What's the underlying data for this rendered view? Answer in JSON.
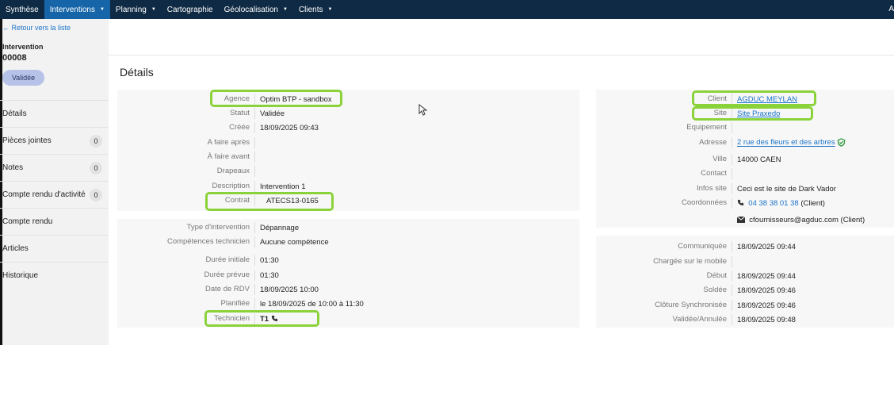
{
  "topnav": {
    "items": [
      {
        "label": "Synthèse",
        "caret": false
      },
      {
        "label": "Interventions",
        "caret": true
      },
      {
        "label": "Planning",
        "caret": true
      },
      {
        "label": "Cartographie",
        "caret": false
      },
      {
        "label": "Géolocalisation",
        "caret": true
      },
      {
        "label": "Clients",
        "caret": true
      }
    ],
    "right_text": "A"
  },
  "sidebar": {
    "back_link": "Retour vers la liste",
    "title": "Intervention",
    "number": "00008",
    "status": "Validée",
    "menu": [
      {
        "label": "Détails",
        "count": ""
      },
      {
        "label": "Pièces jointes",
        "count": "0"
      },
      {
        "label": "Notes",
        "count": "0"
      },
      {
        "label": "Compte rendu d'activité",
        "count": "0"
      },
      {
        "label": "Compte rendu",
        "count": ""
      },
      {
        "label": "Articles",
        "count": ""
      },
      {
        "label": "Historique",
        "count": ""
      }
    ]
  },
  "main": {
    "title": "Détails",
    "left_top": [
      {
        "label": "Agence",
        "value": "Optim BTP - sandbox"
      },
      {
        "label": "Statut",
        "value": "Validée"
      },
      {
        "label": "Créée",
        "value": "18/09/2025 09:43"
      },
      {
        "label": "A faire après",
        "value": ""
      },
      {
        "label": "À faire avant",
        "value": ""
      },
      {
        "label": "Drapeaux",
        "value": ""
      },
      {
        "label": "Description",
        "value": "Intervention 1"
      },
      {
        "label": "Contrat",
        "value": "ATECS13-0165"
      }
    ],
    "left_bottom": [
      {
        "label": "Type d'intervention",
        "value": "Dépannage"
      },
      {
        "label": "Compétences technicien",
        "value": "Aucune compétence"
      },
      {
        "label": "Durée initiale",
        "value": "01:30"
      },
      {
        "label": "Durée prévue",
        "value": "01:30"
      },
      {
        "label": "Date de RDV",
        "value": "18/09/2025 10:00"
      },
      {
        "label": "Planifiée",
        "value": "le 18/09/2025 de 10:00 à 11:30"
      },
      {
        "label": "Technicien",
        "value": "T1"
      }
    ],
    "right_top": {
      "client_label": "Client",
      "client_value": "AGDUC MEYLAN",
      "site_label": "Site",
      "site_value": "Site Praxedo",
      "equipement_label": "Equipement",
      "equipement_value": "",
      "adresse_label": "Adresse",
      "adresse_value": "2 rue des fleurs et des arbres",
      "ville_label": "Ville",
      "ville_value": "14000 CAEN",
      "contact_label": "Contact",
      "contact_value": "",
      "infos_label": "Infos site",
      "infos_value": "Ceci est le site de Dark Vador",
      "coord_label": "Coordonnées",
      "phone": "04 38 38 01 38",
      "phone_suffix": "(Client)",
      "email": "cfournisseurs@agduc.com (Client)"
    },
    "right_bottom": [
      {
        "label": "Communiquée",
        "value": "18/09/2025 09:44"
      },
      {
        "label": "Chargée sur le mobile",
        "value": ""
      },
      {
        "label": "Début",
        "value": "18/09/2025 09:44"
      },
      {
        "label": "Soldée",
        "value": "18/09/2025 09:46"
      },
      {
        "label": "Clôture Synchronisée",
        "value": "18/09/2025 09:46"
      },
      {
        "label": "Validée/Annulée",
        "value": "18/09/2025 09:48"
      }
    ]
  },
  "colors": {
    "nav_bg": "#0f2a44",
    "nav_active": "#1565a8",
    "highlight": "#8bd23a",
    "link": "#1a73c9",
    "status_pill": "#b6c2e8"
  }
}
